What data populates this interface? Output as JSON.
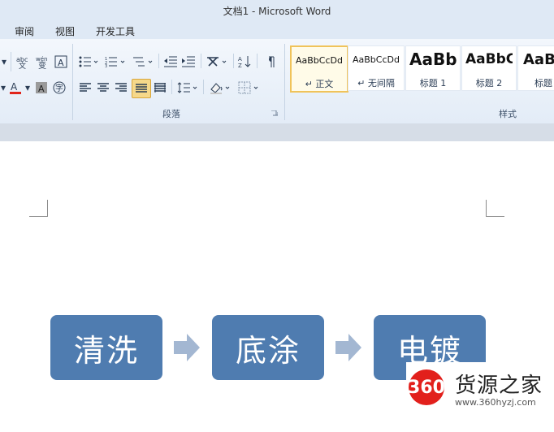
{
  "window": {
    "title": "文档1 - Microsoft Word"
  },
  "menu": {
    "tabs": [
      "审阅",
      "视图",
      "开发工具"
    ]
  },
  "ribbon": {
    "paragraph_group_label": "段落",
    "styles_group_label": "样式",
    "styles": [
      {
        "preview": "AaBbCcDd",
        "name": "↵ 正文",
        "selected": true
      },
      {
        "preview": "AaBbCcDd",
        "name": "↵ 无间隔",
        "selected": false
      },
      {
        "preview": "AaBb",
        "name": "标题 1",
        "selected": false
      },
      {
        "preview": "AaBbC",
        "name": "标题 2",
        "selected": false
      },
      {
        "preview": "AaB",
        "name": "标题",
        "selected": false
      }
    ],
    "font_color_hex": "#e1251b"
  },
  "document": {
    "flow": [
      "清洗",
      "底涂",
      "电镀"
    ],
    "box_color": "#4f7cb0",
    "arrow_color": "#a3b7d2"
  },
  "watermark": {
    "logo": "360",
    "text": "货源之家",
    "url": "www.360hyzj.com"
  }
}
